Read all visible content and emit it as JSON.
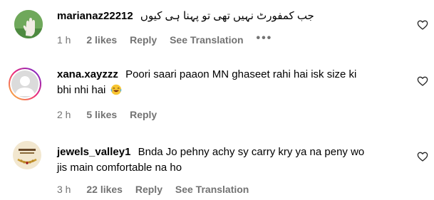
{
  "comments": [
    {
      "username": "marianaz22212",
      "text": "جب کمفورٹ نہیں تھی تو پہنا ہی کیوں",
      "time": "1 h",
      "likes": "2 likes",
      "reply": "Reply",
      "see_translation": "See Translation",
      "more": "•••",
      "avatar_icon": "hand-photo-icon"
    },
    {
      "username": "xana.xayzzz",
      "text_line1": "Poori saari paaon MN ghaseet rahi hai isk size ki",
      "text_line2": "bhi nhi hai",
      "time": "2 h",
      "likes": "5 likes",
      "reply": "Reply",
      "avatar_icon": "default-user-icon"
    },
    {
      "username": "jewels_valley1",
      "text_line1": "Bnda Jo pehny achy sy carry kry ya na peny wo",
      "text_line2": "jis main comfortable na ho",
      "time": "3 h",
      "likes": "22 likes",
      "reply": "Reply",
      "see_translation": "See Translation",
      "avatar_icon": "jewelry-logo-icon"
    }
  ],
  "colors": {
    "meta": "#737373",
    "story_ring_start": "#f9ce34",
    "story_ring_mid": "#ee2a7b",
    "story_ring_end": "#6228d7"
  }
}
